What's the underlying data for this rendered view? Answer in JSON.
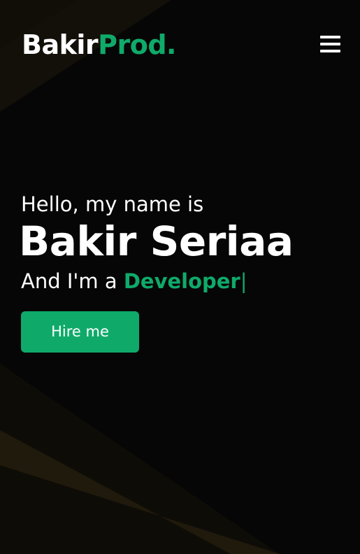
{
  "brand": {
    "name_part1": "Bakir",
    "name_part2": "Prod."
  },
  "nav": {
    "menu_icon": "hamburger-menu-icon"
  },
  "hero": {
    "greeting": "Hello, my name is",
    "name": "Bakir Seriaa",
    "role_prefix": "And I'm a",
    "role": "Developer",
    "cursor": "|",
    "cta_label": "Hire me"
  },
  "colors": {
    "background": "#060606",
    "accent": "#0faa6a",
    "text": "#ffffff",
    "decorative_shape": "#1a1608"
  }
}
